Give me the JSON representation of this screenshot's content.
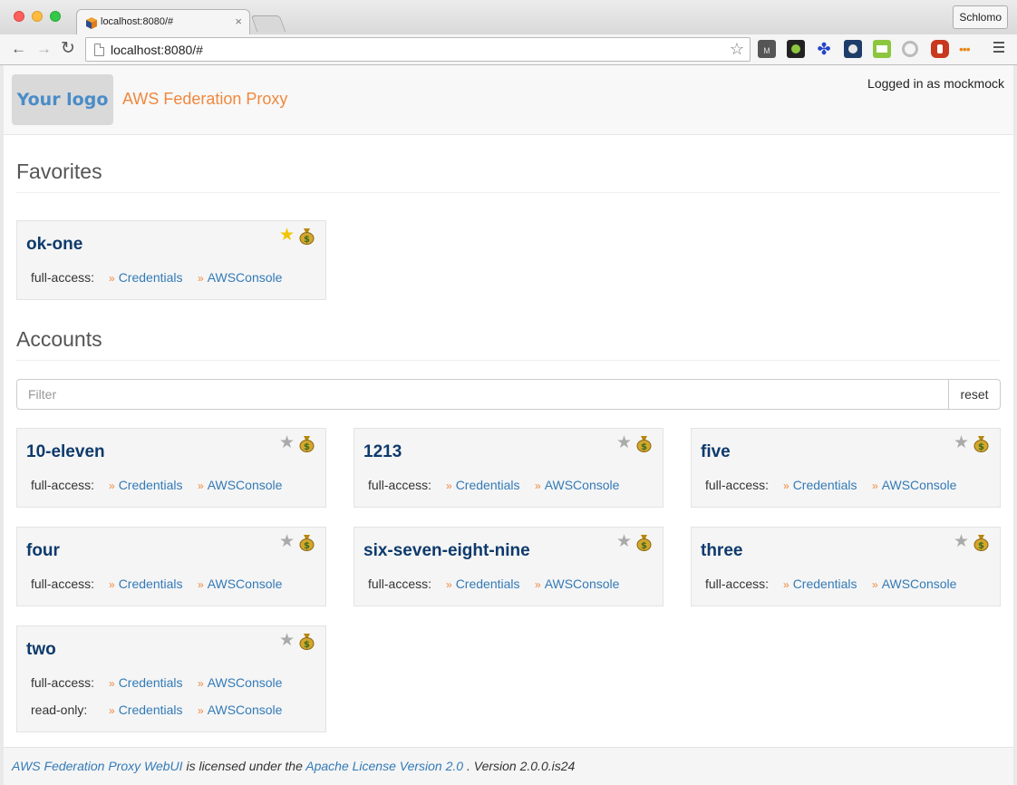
{
  "browser": {
    "tab_title": "localhost:8080/#",
    "tab_close": "×",
    "url": "localhost:8080/#",
    "profile": "Schlomo",
    "back": "←",
    "forward": "→",
    "reload": "↻",
    "bookmark": "☆"
  },
  "header": {
    "logo": "Your logo",
    "brand": "AWS Federation Proxy",
    "logged_in": "Logged in as mockmock"
  },
  "favorites": {
    "title": "Favorites",
    "cards": [
      {
        "name": "ok-one",
        "favorite": true,
        "roles": [
          {
            "role": "full-access:",
            "credentials": "Credentials",
            "console": "AWSConsole"
          }
        ]
      }
    ]
  },
  "accounts": {
    "title": "Accounts",
    "filter_placeholder": "Filter",
    "reset_label": "reset",
    "cards": [
      {
        "name": "10-eleven",
        "favorite": false,
        "roles": [
          {
            "role": "full-access:",
            "credentials": "Credentials",
            "console": "AWSConsole"
          }
        ]
      },
      {
        "name": "1213",
        "favorite": false,
        "roles": [
          {
            "role": "full-access:",
            "credentials": "Credentials",
            "console": "AWSConsole"
          }
        ]
      },
      {
        "name": "five",
        "favorite": false,
        "roles": [
          {
            "role": "full-access:",
            "credentials": "Credentials",
            "console": "AWSConsole"
          }
        ]
      },
      {
        "name": "four",
        "favorite": false,
        "roles": [
          {
            "role": "full-access:",
            "credentials": "Credentials",
            "console": "AWSConsole"
          }
        ]
      },
      {
        "name": "six-seven-eight-nine",
        "favorite": false,
        "roles": [
          {
            "role": "full-access:",
            "credentials": "Credentials",
            "console": "AWSConsole"
          }
        ]
      },
      {
        "name": "three",
        "favorite": false,
        "roles": [
          {
            "role": "full-access:",
            "credentials": "Credentials",
            "console": "AWSConsole"
          }
        ]
      },
      {
        "name": "two",
        "favorite": false,
        "roles": [
          {
            "role": "full-access:",
            "credentials": "Credentials",
            "console": "AWSConsole"
          },
          {
            "role": "read-only:",
            "credentials": "Credentials",
            "console": "AWSConsole"
          }
        ]
      }
    ]
  },
  "card_icons": {
    "star": "★",
    "raquo": "»",
    "money": "money-bag-icon"
  },
  "footer": {
    "project_link": "AWS Federation Proxy WebUI",
    "licensed_text": "is licensed under the",
    "license_link": "Apache License Version 2.0",
    "version_text": ". Version 2.0.0.is24"
  },
  "colors": {
    "accent_orange": "#f0883e",
    "link_blue": "#337ab7",
    "title_navy": "#0e3a6c",
    "star_gold": "#f3c400"
  }
}
